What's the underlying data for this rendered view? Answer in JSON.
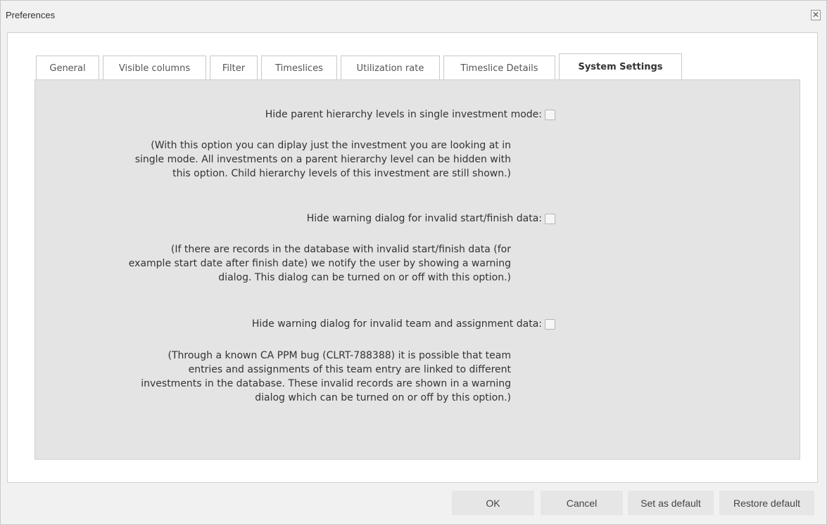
{
  "dialog": {
    "title": "Preferences",
    "close_glyph": "✕"
  },
  "tabs": [
    {
      "label": "General",
      "active": false
    },
    {
      "label": "Visible columns",
      "active": false
    },
    {
      "label": "Filter",
      "active": false
    },
    {
      "label": "Timeslices",
      "active": false
    },
    {
      "label": "Utilization rate",
      "active": false
    },
    {
      "label": "Timeslice Details",
      "active": false
    },
    {
      "label": "System Settings",
      "active": true
    }
  ],
  "settings": [
    {
      "label": "Hide parent hierarchy levels in single investment mode:",
      "checked": false,
      "description": [
        "(With this option you can diplay just the investment you are looking at in",
        "single mode. All investments on a parent hierarchy level can be hidden with",
        "this option. Child hierarchy levels of this investment are still shown.)"
      ]
    },
    {
      "label": "Hide warning dialog for invalid start/finish data:",
      "checked": false,
      "description": [
        "(If there are records in the database with invalid start/finish data (for",
        "example start date after finish date) we notify the user by showing a warning",
        "dialog. This dialog can be turned on or off with this option.)"
      ]
    },
    {
      "label": "Hide warning dialog for invalid team and assignment data:",
      "checked": false,
      "description": [
        "(Through a known CA PPM bug (CLRT-788388) it is possible that team",
        "entries and assignments of this team entry are linked to different",
        "investments in the database. These invalid records are shown in a warning",
        "dialog which can be turned on or off by this option.)"
      ]
    }
  ],
  "buttons": {
    "ok": "OK",
    "cancel": "Cancel",
    "set_default": "Set as default",
    "restore_default": "Restore default"
  },
  "colors": {
    "dialog_bg": "#f1f1f1",
    "tab_body_bg": "#e4e4e4",
    "button_bg": "#e6e6e6"
  }
}
